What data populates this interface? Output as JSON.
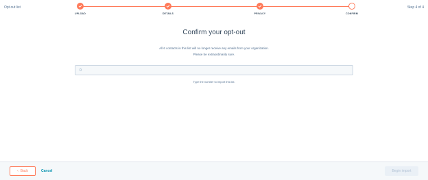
{
  "header": {
    "title": "Opt out list",
    "step_counter": "Step 4 of 4"
  },
  "stepper": {
    "accent_color": "#ff7a59",
    "steps": [
      {
        "label": "UPLOAD",
        "state": "done",
        "icon": "check-icon"
      },
      {
        "label": "DETAILS",
        "state": "done",
        "icon": "check-icon"
      },
      {
        "label": "PRIVACY",
        "state": "done",
        "icon": "check-icon"
      },
      {
        "label": "CONFIRM",
        "state": "current",
        "icon": ""
      }
    ]
  },
  "main": {
    "title": "Confirm your opt-out",
    "description_line1": "All 6 contacts in this list will no longer receive any emails from your organization.",
    "description_line2": "Please be extraordinarily sure.",
    "input_value": "0",
    "input_help": "Type the number to import this list."
  },
  "footer": {
    "back_label": "Back",
    "back_icon": "chevron-left-icon",
    "cancel_label": "Cancel",
    "begin_label": "Begin import"
  }
}
